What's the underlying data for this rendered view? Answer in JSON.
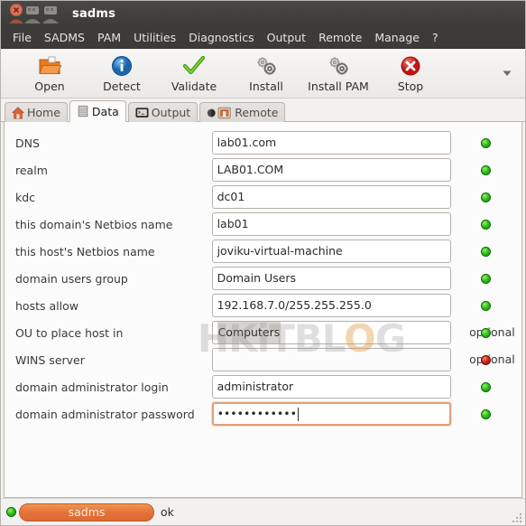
{
  "window": {
    "title": "sadms",
    "icon": "sadms-app-icon"
  },
  "menubar": {
    "items": [
      {
        "label": "File",
        "name": "menu-file"
      },
      {
        "label": "SADMS",
        "name": "menu-sadms"
      },
      {
        "label": "PAM",
        "name": "menu-pam"
      },
      {
        "label": "Utilities",
        "name": "menu-utilities"
      },
      {
        "label": "Diagnostics",
        "name": "menu-diagnostics"
      },
      {
        "label": "Output",
        "name": "menu-output"
      },
      {
        "label": "Remote",
        "name": "menu-remote"
      },
      {
        "label": "Manage",
        "name": "menu-manage"
      },
      {
        "label": "?",
        "name": "menu-help"
      }
    ]
  },
  "toolbar": {
    "buttons": [
      {
        "label": "Open",
        "icon": "folder-open-icon",
        "name": "toolbar-open-button"
      },
      {
        "label": "Detect",
        "icon": "info-icon",
        "name": "toolbar-detect-button"
      },
      {
        "label": "Validate",
        "icon": "checkmark-icon",
        "name": "toolbar-validate-button"
      },
      {
        "label": "Install",
        "icon": "gears-icon",
        "name": "toolbar-install-button"
      },
      {
        "label": "Install PAM",
        "icon": "gears-icon",
        "name": "toolbar-install-pam-button"
      },
      {
        "label": "Stop",
        "icon": "stop-error-icon",
        "name": "toolbar-stop-button"
      }
    ],
    "overflow_icon": "chevron-down-icon"
  },
  "tabs": [
    {
      "label": "Home",
      "icon": "home-icon",
      "active": false,
      "name": "tab-home"
    },
    {
      "label": "Data",
      "icon": "database-icon",
      "active": true,
      "name": "tab-data"
    },
    {
      "label": "Output",
      "icon": "terminal-icon",
      "active": false,
      "name": "tab-output"
    },
    {
      "label": "Remote",
      "icon": "remote-desktop-icon",
      "active": false,
      "name": "tab-remote"
    }
  ],
  "form": {
    "rows": [
      {
        "label": "DNS",
        "value": "lab01.com",
        "status": "green",
        "optional": "",
        "focused": false,
        "masked": false,
        "selected": false
      },
      {
        "label": "realm",
        "value": "LAB01.COM",
        "status": "green",
        "optional": "",
        "focused": false,
        "masked": false,
        "selected": false
      },
      {
        "label": "kdc",
        "value": "dc01",
        "status": "green",
        "optional": "",
        "focused": false,
        "masked": false,
        "selected": false
      },
      {
        "label": "this domain's Netbios name",
        "value": "lab01",
        "status": "green",
        "optional": "",
        "focused": false,
        "masked": false,
        "selected": false
      },
      {
        "label": "this host's Netbios name",
        "value": "joviku-virtual-machine",
        "status": "green",
        "optional": "",
        "focused": false,
        "masked": false,
        "selected": false
      },
      {
        "label": "domain users group",
        "value": "Domain Users",
        "status": "green",
        "optional": "",
        "focused": false,
        "masked": false,
        "selected": false
      },
      {
        "label": "hosts allow",
        "value": "192.168.7.0/255.255.255.0",
        "status": "green",
        "optional": "",
        "focused": false,
        "masked": false,
        "selected": false
      },
      {
        "label": "OU to place host in",
        "value": "Computers",
        "status": "green",
        "optional": "optional",
        "focused": false,
        "masked": false,
        "selected": true
      },
      {
        "label": "WINS server",
        "value": "",
        "status": "red",
        "optional": "optional",
        "focused": false,
        "masked": false,
        "selected": false
      },
      {
        "label": "domain administrator login",
        "value": "administrator",
        "status": "green",
        "optional": "",
        "focused": false,
        "masked": false,
        "selected": false
      },
      {
        "label": "domain administrator password",
        "value": "••••••••••••",
        "status": "green",
        "optional": "",
        "focused": true,
        "masked": true,
        "selected": false
      }
    ]
  },
  "watermark": {
    "part1": "HKiTB",
    "part2": "L",
    "part3": "O",
    "part4": "G"
  },
  "statusbar": {
    "indicator": "status-green-dot",
    "progress_label": "sadms",
    "message": "ok"
  },
  "colors": {
    "accent_orange": "#e4733a",
    "status_green": "#35c020",
    "status_red": "#cc2a1c",
    "titlebar_bg": "#3c3b39",
    "content_bg": "#fbfbfb"
  }
}
